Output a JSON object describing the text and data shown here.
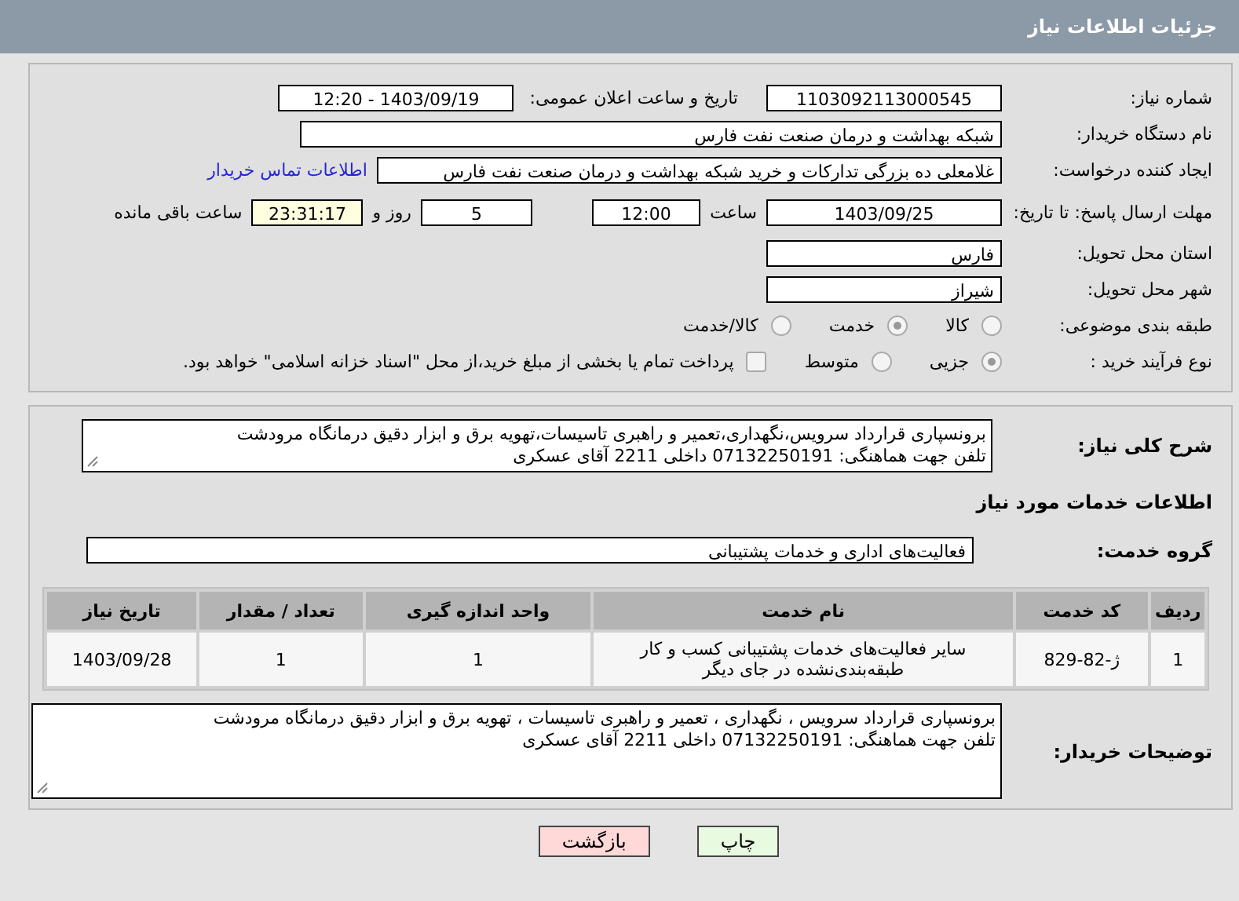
{
  "header": {
    "title": "جزئیات اطلاعات نیاز"
  },
  "need_number": {
    "label": "شماره نیاز:",
    "value": "1103092113000545"
  },
  "announce": {
    "label": "تاریخ و ساعت اعلان عمومی:",
    "value": "1403/09/19 - 12:20"
  },
  "buyer_org": {
    "label": "نام دستگاه خریدار:",
    "value": "شبکه بهداشت و درمان صنعت نفت فارس"
  },
  "requester": {
    "label": "ایجاد کننده درخواست:",
    "value": "غلامعلی ده بزرگی تدارکات و خرید شبکه بهداشت و درمان صنعت نفت فارس",
    "contact_link": "اطلاعات تماس خریدار"
  },
  "deadline": {
    "label": "مهلت ارسال پاسخ: تا تاریخ:",
    "date": "1403/09/25",
    "time_label": "ساعت",
    "time": "12:00",
    "days": "5",
    "days_label": "روز و",
    "remaining": "23:31:17",
    "remaining_label": "ساعت باقی مانده"
  },
  "province": {
    "label": "استان محل تحویل:",
    "value": "فارس"
  },
  "city": {
    "label": "شهر محل تحویل:",
    "value": "شیراز"
  },
  "category": {
    "label": "طبقه بندی موضوعی:",
    "options": [
      {
        "label": "کالا",
        "selected": false
      },
      {
        "label": "خدمت",
        "selected": true
      },
      {
        "label": "کالا/خدمت",
        "selected": false
      }
    ]
  },
  "process": {
    "label": "نوع فرآیند خرید :",
    "options": [
      {
        "label": "جزیی",
        "selected": true
      },
      {
        "label": "متوسط",
        "selected": false
      }
    ],
    "payment_note": {
      "checked": false,
      "text": "پرداخت تمام یا بخشی از مبلغ خرید،از محل \"اسناد خزانه اسلامی\" خواهد بود."
    }
  },
  "description": {
    "label": "شرح کلی نیاز:",
    "lines": [
      "برونسپاری قرارداد سرویس،نگهداری،تعمیر و راهبری تاسیسات،تهویه برق و ابزار دقیق درمانگاه مرودشت",
      "تلفن جهت هماهنگی: 07132250191 داخلی 2211 آقای عسکری"
    ]
  },
  "services_heading": "اطلاعات خدمات مورد نیاز",
  "service_group": {
    "label": "گروه خدمت:",
    "value": "فعالیت‌های اداری و خدمات پشتیبانی"
  },
  "table": {
    "columns": [
      "ردیف",
      "کد خدمت",
      "نام خدمت",
      "واحد اندازه گیری",
      "تعداد / مقدار",
      "تاریخ نیاز"
    ],
    "rows": [
      [
        "1",
        "ژ-82-829",
        "سایر فعالیت‌های خدمات پشتیبانی کسب و کار طبقه‌بندی‌نشده در جای دیگر",
        "1",
        "1",
        "1403/09/28"
      ]
    ]
  },
  "buyer_notes": {
    "label": "توضیحات خریدار:",
    "lines": [
      "برونسپاری قرارداد سرویس ، نگهداری ، تعمیر و راهبری تاسیسات ، تهویه برق و ابزار دقیق درمانگاه مرودشت",
      "تلفن جهت هماهنگی: 07132250191 داخلی 2211 آقای عسکری"
    ]
  },
  "buttons": [
    {
      "label": "چاپ",
      "kind": "print"
    },
    {
      "label": "بازگشت",
      "kind": "back"
    }
  ]
}
